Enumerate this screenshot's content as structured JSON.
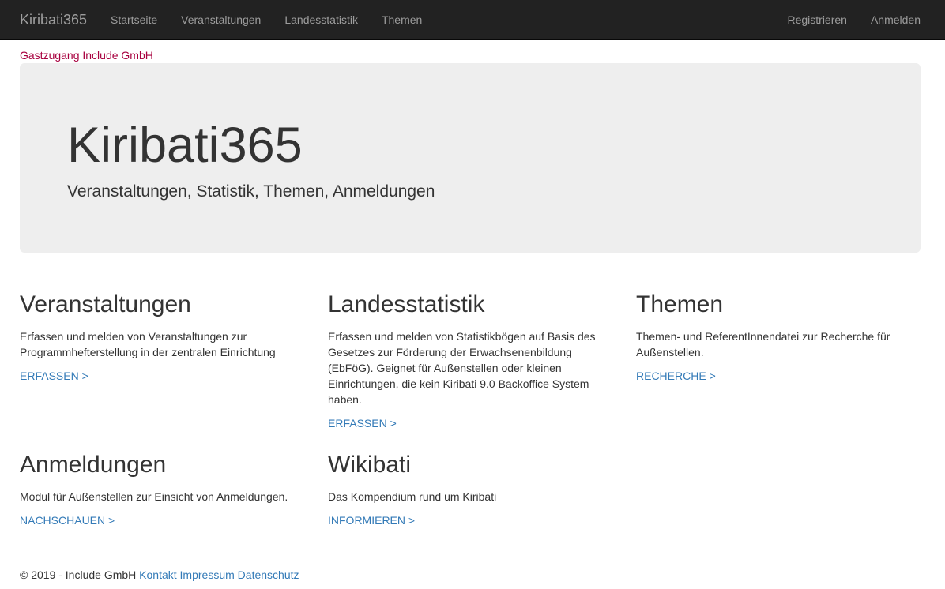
{
  "navbar": {
    "brand": "Kiribati365",
    "left_items": [
      "Startseite",
      "Veranstaltungen",
      "Landesstatistik",
      "Themen"
    ],
    "right_items": [
      "Registrieren",
      "Anmelden"
    ]
  },
  "guest_label": "Gastzugang Include GmbH",
  "jumbotron": {
    "title": "Kiribati365",
    "subtitle": "Veranstaltungen, Statistik, Themen, Anmeldungen"
  },
  "cards": [
    {
      "title": "Veranstaltungen",
      "text": "Erfassen und melden von Veranstaltungen zur Programmhefterstellung in der zentralen Einrichtung",
      "link": "ERFASSEN >"
    },
    {
      "title": "Landesstatistik",
      "text": "Erfassen und melden von Statistikbögen auf Basis des Gesetzes zur Förderung der Erwachsenenbildung (EbFöG). Geignet für Außenstellen oder kleinen Einrichtungen, die kein Kiribati 9.0 Backoffice System haben.",
      "link": "ERFASSEN >"
    },
    {
      "title": "Themen",
      "text": "Themen- und ReferentInnendatei zur Recherche für Außenstellen.",
      "link": "RECHERCHE >"
    },
    {
      "title": "Anmeldungen",
      "text": "Modul für Außenstellen zur Einsicht von Anmeldungen.",
      "link": "NACHSCHAUEN >"
    },
    {
      "title": "Wikibati",
      "text": "Das Kompendium rund um Kiribati",
      "link": "INFORMIEREN >"
    }
  ],
  "footer": {
    "copyright": "© 2019 - Include GmbH",
    "links": [
      "Kontakt",
      "Impressum",
      "Datenschutz"
    ]
  }
}
